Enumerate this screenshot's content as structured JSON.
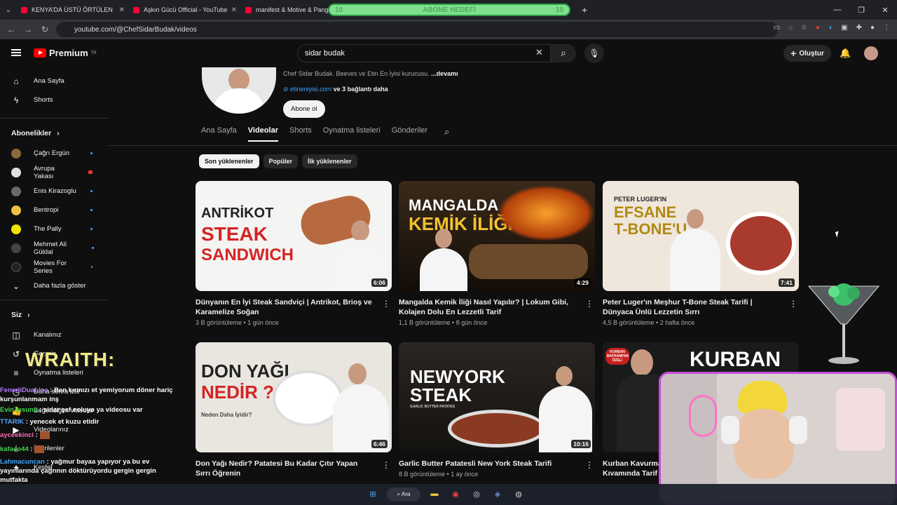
{
  "browser": {
    "tabs": [
      {
        "title": "KENYA'DA ÜSTÜ ÖRTÜLEN KOR"
      },
      {
        "title": "Aşkın Gücü Official - YouTube"
      },
      {
        "title": "manifest & Motive & Pango"
      }
    ],
    "url": "youtube.com/@ChefSidarBudak/videos",
    "goal_banner": {
      "left": "10",
      "text": "ABONE HEDEFİ",
      "right": "10"
    }
  },
  "header": {
    "logo_text": "Premium",
    "logo_region": "TR",
    "search_value": "sidar budak",
    "create_label": "Oluştur"
  },
  "sidebar": {
    "main": [
      {
        "label": "Ana Sayfa",
        "icon": "home-icon"
      },
      {
        "label": "Shorts",
        "icon": "shorts-icon"
      }
    ],
    "subs_title": "Abonelikler",
    "subscriptions": [
      {
        "label": "Çağrı Ergün",
        "color": "#8a6a3a"
      },
      {
        "label": "Avrupa Yakası",
        "color": "#e0e0e0"
      },
      {
        "label": "Enis Kirazoglu",
        "color": "#6a6a6a"
      },
      {
        "label": "Bentropi",
        "color": "#f0c040"
      },
      {
        "label": "The Pally",
        "color": "#f2e600"
      },
      {
        "label": "Mehmet Ali Güldal",
        "color": "#444"
      },
      {
        "label": "Movies For Series",
        "color": "#222"
      }
    ],
    "show_more": "Daha fazla göster",
    "you_title": "Siz",
    "you_items": [
      {
        "label": "Kanalınız"
      },
      {
        "label": "Geçmiş"
      },
      {
        "label": "Oynatma listeleri"
      },
      {
        "label": "Daha sonra izle"
      },
      {
        "label": "Beğendiğim videolar"
      },
      {
        "label": "Videolarınız"
      },
      {
        "label": "İndirilenler"
      },
      {
        "label": "Keşfet"
      }
    ]
  },
  "channel": {
    "description": "Chef Sidar Budak. Beeves ve Etin En İyisi  kurucusu. ",
    "more": "...devamı",
    "link": "etineniyisi.com",
    "links_more": " ve 3 bağlantı daha",
    "subscribe": "Abone ol",
    "tabs": [
      "Ana Sayfa",
      "Videolar",
      "Shorts",
      "Oynatma listeleri",
      "Gönderiler"
    ],
    "chips": [
      "Son yüklenenler",
      "Popüler",
      "İlk yüklenenler"
    ]
  },
  "videos": [
    {
      "title": "Dünyanın En İyi Steak Sandviçi | Antrikot, Brioş ve Karamelize Soğan",
      "views": "3 B görüntüleme",
      "age": "1 gün önce",
      "duration": "6:06",
      "thumb_lines": [
        "ANTRİKOT",
        "STEAK",
        "SANDWICH"
      ]
    },
    {
      "title": "Mangalda Kemik İliği Nasıl Yapılır? | Lokum Gibi, Kolajen Dolu En Lezzetli Tarif",
      "views": "1,1 B görüntüleme",
      "age": "8 gün önce",
      "duration": "4:29",
      "thumb_lines": [
        "MANGALDA",
        "KEMİK İLİĞİ"
      ]
    },
    {
      "title": "Peter Luger'ın Meşhur T-Bone Steak Tarifi | Dünyaca Ünlü Lezzetin Sırrı",
      "views": "4,5 B görüntüleme",
      "age": "2 hafta önce",
      "duration": "7:41",
      "thumb_lines": [
        "PETER LUGER'IN",
        "EFSANE",
        "T-BONE'U"
      ]
    },
    {
      "title": "Don Yağı Nedir? Patatesi Bu Kadar Çıtır Yapan Sırrı Öğrenin",
      "views": "",
      "age": "",
      "duration": "6:46",
      "thumb_lines": [
        "DON YAĞI",
        "NEDİR ?",
        "Neden Daha İyidir?"
      ]
    },
    {
      "title": "Garlic Butter Patatesli New York Steak Tarifi",
      "views": "8 B görüntüleme",
      "age": "1 ay önce",
      "duration": "10:16",
      "thumb_lines": [
        "NEWYORK",
        "STEAK",
        "GARLIC BUTTER PATATES"
      ]
    },
    {
      "title": "Kurban Kavurma",
      "title2": "Kıvamında Tarif",
      "views": "",
      "age": "",
      "duration": "",
      "thumb_lines": [
        "KURBAN",
        "KURBAN BAYRAMI'NA ÖZEL!"
      ]
    }
  ],
  "stream_overlay": {
    "brand": "WRAITH:",
    "chat": [
      {
        "user": "FenerliDuaLipa",
        "msg": " : Ben kırmızı et yemiyorum döner hariç kurşunlanmam inş",
        "color": "#b57bff"
      },
      {
        "user": "EvinTosunu",
        "msg": " : sidar şef noluyo ya videosu var",
        "color": "#3fd24e"
      },
      {
        "user": "TTARIK",
        "msg": " : yenecek et kuzu etidir",
        "color": "#4ea8ff"
      },
      {
        "user": "ayceekinci",
        "msg": " :",
        "color": "#ff6ab5"
      },
      {
        "user": "kafaco44",
        "msg": " :",
        "color": "#3fd24e"
      },
      {
        "user": "Lahmacuncan",
        "msg": " : yağmur bayaa yapıyor ya bu ev yayınlarında çağrının döktürüyordu gergin gergin mutfakta",
        "color": "#3ea6ff"
      }
    ]
  },
  "taskbar": {
    "search": "Ara"
  }
}
